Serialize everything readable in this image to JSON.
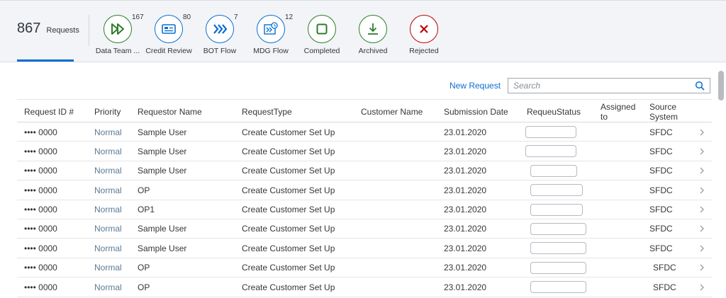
{
  "header": {
    "total_count": "867",
    "total_label": "Requests",
    "tabs": [
      {
        "label": "Data Team ...",
        "count": "167",
        "icon": "double-play-icon",
        "color": "#2b7d2b"
      },
      {
        "label": "Credit Review",
        "count": "80",
        "icon": "id-card-icon",
        "color": "#0a6ed1"
      },
      {
        "label": "BOT Flow",
        "count": "7",
        "icon": "triple-chevron-right-icon",
        "color": "#0a6ed1"
      },
      {
        "label": "MDG Flow",
        "count": "12",
        "icon": "workflow-clock-icon",
        "color": "#0a6ed1"
      },
      {
        "label": "Completed",
        "count": "",
        "icon": "stop-square-icon",
        "color": "#2b7d2b"
      },
      {
        "label": "Archived",
        "count": "",
        "icon": "download-icon",
        "color": "#2b7d2b"
      },
      {
        "label": "Rejected",
        "count": "",
        "icon": "close-x-icon",
        "color": "#bb0000"
      }
    ]
  },
  "toolbar": {
    "new_request_label": "New Request",
    "search_placeholder": "Search"
  },
  "table": {
    "columns": {
      "request_id": "Request ID #",
      "priority": "Priority",
      "requestor": "Requestor Name",
      "request_type": "RequestType",
      "customer": "Customer Name",
      "submission_date": "Submission Date",
      "status": "RequeuStatus",
      "assigned": "Assigned to",
      "source": "Source System"
    },
    "rows": [
      {
        "id": "•••• 0000",
        "priority": "Normal",
        "requestor": "Sample User",
        "type": "Create Customer Set Up",
        "customer": "",
        "date": "23.01.2020",
        "source": "SFDC"
      },
      {
        "id": "•••• 0000",
        "priority": "Normal",
        "requestor": "Sample User",
        "type": "Create Customer Set Up",
        "customer": "",
        "date": "23.01.2020",
        "source": "SFDC"
      },
      {
        "id": "•••• 0000",
        "priority": "Normal",
        "requestor": "Sample User",
        "type": "Create Customer Set Up",
        "customer": "",
        "date": "23.01.2020",
        "source": "SFDC"
      },
      {
        "id": "•••• 0000",
        "priority": "Normal",
        "requestor": "OP",
        "type": "Create Customer Set Up",
        "customer": "",
        "date": "23.01.2020",
        "source": "SFDC"
      },
      {
        "id": "•••• 0000",
        "priority": "Normal",
        "requestor": "OP1",
        "type": "Create Customer Set Up",
        "customer": "",
        "date": "23.01.2020",
        "source": "SFDC"
      },
      {
        "id": "•••• 0000",
        "priority": "Normal",
        "requestor": "Sample User",
        "type": "Create Customer Set Up",
        "customer": "",
        "date": "23.01.2020",
        "source": "SFDC"
      },
      {
        "id": "•••• 0000",
        "priority": "Normal",
        "requestor": "Sample User",
        "type": "Create Customer Set Up",
        "customer": "",
        "date": "23.01.2020",
        "source": "SFDC"
      },
      {
        "id": "•••• 0000",
        "priority": "Normal",
        "requestor": "OP",
        "type": "Create Customer Set Up",
        "customer": "",
        "date": "23.01.2020",
        "source": "SFDC"
      },
      {
        "id": "•••• 0000",
        "priority": "Normal",
        "requestor": "OP",
        "type": "Create Customer Set Up",
        "customer": "",
        "date": "23.01.2020",
        "source": "SFDC"
      }
    ]
  },
  "colors": {
    "accent": "#0a6ed1",
    "positive": "#2b7d2b",
    "negative": "#bb0000"
  }
}
